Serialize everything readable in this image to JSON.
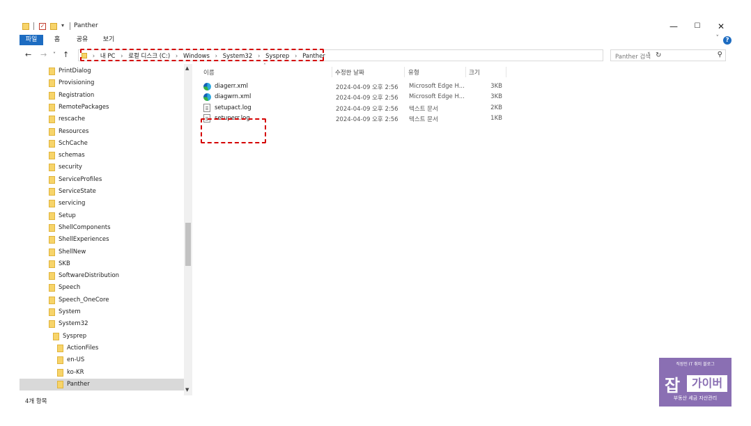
{
  "window": {
    "title": "Panther",
    "controls": {
      "minimize": "—",
      "maximize": "☐",
      "close": "✕"
    }
  },
  "ribbon": {
    "tabs": [
      "파일",
      "홈",
      "공유",
      "보기"
    ],
    "help": "?"
  },
  "nav": {
    "back": "←",
    "forward": "→",
    "recent": "˅",
    "up": "↑",
    "breadcrumb": [
      "내 PC",
      "로컬 디스크 (C:)",
      "Windows",
      "System32",
      "Sysprep",
      "Panther"
    ],
    "separator": "›",
    "search_placeholder": "Panther 검색"
  },
  "tree": {
    "items": [
      {
        "label": "PrintDialog",
        "level": 0
      },
      {
        "label": "Provisioning",
        "level": 0
      },
      {
        "label": "Registration",
        "level": 0
      },
      {
        "label": "RemotePackages",
        "level": 0
      },
      {
        "label": "rescache",
        "level": 0
      },
      {
        "label": "Resources",
        "level": 0
      },
      {
        "label": "SchCache",
        "level": 0
      },
      {
        "label": "schemas",
        "level": 0
      },
      {
        "label": "security",
        "level": 0
      },
      {
        "label": "ServiceProfiles",
        "level": 0
      },
      {
        "label": "ServiceState",
        "level": 0
      },
      {
        "label": "servicing",
        "level": 0
      },
      {
        "label": "Setup",
        "level": 0
      },
      {
        "label": "ShellComponents",
        "level": 0
      },
      {
        "label": "ShellExperiences",
        "level": 0
      },
      {
        "label": "ShellNew",
        "level": 0
      },
      {
        "label": "SKB",
        "level": 0
      },
      {
        "label": "SoftwareDistribution",
        "level": 0
      },
      {
        "label": "Speech",
        "level": 0
      },
      {
        "label": "Speech_OneCore",
        "level": 0
      },
      {
        "label": "System",
        "level": 0
      },
      {
        "label": "System32",
        "level": 0
      },
      {
        "label": "Sysprep",
        "level": 1
      },
      {
        "label": "ActionFiles",
        "level": 2
      },
      {
        "label": "en-US",
        "level": 2
      },
      {
        "label": "ko-KR",
        "level": 2
      },
      {
        "label": "Panther",
        "level": 2,
        "selected": true
      }
    ]
  },
  "list": {
    "headers": {
      "name": "이름",
      "date": "수정한 날짜",
      "type": "유형",
      "size": "크기"
    },
    "files": [
      {
        "name": "diagerr.xml",
        "date": "2024-04-09 오후 2:56",
        "type": "Microsoft Edge H...",
        "size": "3KB",
        "icon": "edge"
      },
      {
        "name": "diagwrn.xml",
        "date": "2024-04-09 오후 2:56",
        "type": "Microsoft Edge H...",
        "size": "3KB",
        "icon": "edge"
      },
      {
        "name": "setupact.log",
        "date": "2024-04-09 오후 2:56",
        "type": "텍스트 문서",
        "size": "2KB",
        "icon": "text"
      },
      {
        "name": "setuperr.log",
        "date": "2024-04-09 오후 2:56",
        "type": "텍스트 문서",
        "size": "1KB",
        "icon": "text"
      }
    ]
  },
  "status": {
    "item_count": "4개 항목"
  },
  "watermark": {
    "top": "직장인 IT 취미 블로그",
    "char": "잡",
    "name": "가이버",
    "bottom": "부동산 세금 자산관리"
  }
}
